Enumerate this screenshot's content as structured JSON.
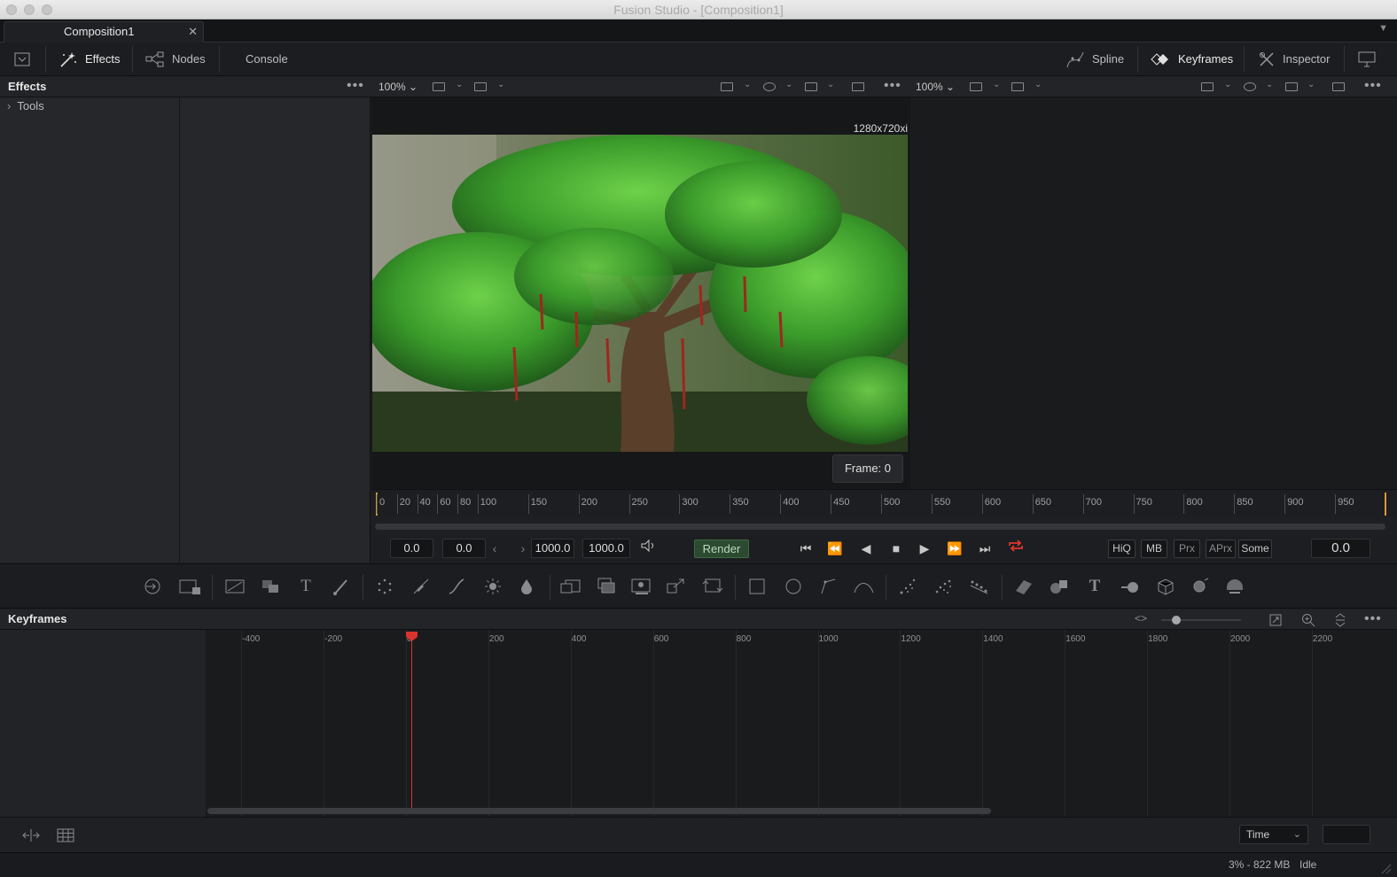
{
  "window": {
    "title": "Fusion Studio - [Composition1]"
  },
  "tabs": [
    {
      "label": "Composition1",
      "close": "✕"
    }
  ],
  "toolbar": {
    "effects": "Effects",
    "nodes": "Nodes",
    "console": "Console",
    "spline": "Spline",
    "keyframes": "Keyframes",
    "inspector": "Inspector"
  },
  "effects_panel": {
    "title": "Effects",
    "tree_items": [
      {
        "label": "Tools",
        "icon": "chevron-right-icon"
      }
    ]
  },
  "viewer_left": {
    "zoom": "100%",
    "resolution": "1280x720xi",
    "frame_label": "Frame: 0"
  },
  "viewer_right": {
    "zoom": "100%"
  },
  "ruler": {
    "labels": [
      "0",
      "20",
      "40",
      "60",
      "80",
      "100",
      "150",
      "200",
      "250",
      "300",
      "350",
      "400",
      "450",
      "500",
      "550",
      "600",
      "650",
      "700",
      "750",
      "800",
      "850",
      "900",
      "950"
    ]
  },
  "transport": {
    "current_start": "0.0",
    "global_start": "0.0",
    "render_end": "1000.0",
    "global_end": "1000.0",
    "render_button": "Render",
    "hiq": "HiQ",
    "mb": "MB",
    "prx": "Prx",
    "aprx": "APrx",
    "some": "Some",
    "current_time": "0.0"
  },
  "keyframes": {
    "title": "Keyframes",
    "axis_labels": [
      "-400",
      "-200",
      "0",
      "200",
      "400",
      "600",
      "800",
      "1000",
      "1200",
      "1400",
      "1600",
      "1800",
      "2000",
      "2200"
    ],
    "time_mode": "Time"
  },
  "status": {
    "memory": "3% - 822 MB",
    "state": "Idle"
  },
  "colors": {
    "accent_red": "#d2332f",
    "loop_icon": "#e0352f",
    "render_green": "#2c4a30"
  }
}
